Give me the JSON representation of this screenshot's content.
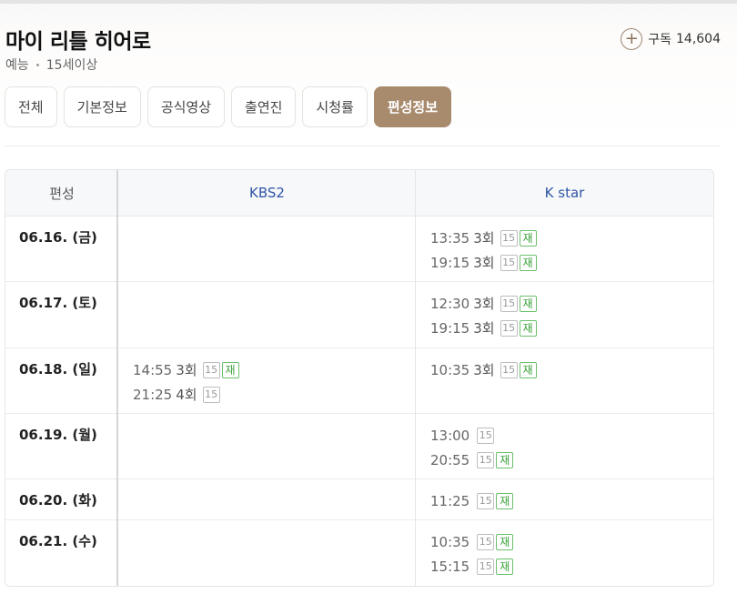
{
  "program": {
    "title": "마이 리틀 히어로",
    "genre": "예능",
    "rating": "15세이상"
  },
  "subscribe": {
    "icon": "plus-icon",
    "label": "구독",
    "count": "14,604"
  },
  "tabs": [
    {
      "label": "전체"
    },
    {
      "label": "기본정보"
    },
    {
      "label": "공식영상"
    },
    {
      "label": "출연진"
    },
    {
      "label": "시청률"
    },
    {
      "label": "편성정보",
      "active": true
    }
  ],
  "schedule": {
    "header": {
      "date_col": "편성",
      "channel1": "KBS2",
      "channel2": "K star"
    },
    "badges": {
      "age": "15",
      "rerun": "재"
    },
    "rows": [
      {
        "date": "06.16. (금)",
        "kbs2": [],
        "kstar": [
          {
            "time": "13:35",
            "ep": "3회",
            "rerun": true
          },
          {
            "time": "19:15",
            "ep": "3회",
            "rerun": true
          }
        ]
      },
      {
        "date": "06.17. (토)",
        "kbs2": [],
        "kstar": [
          {
            "time": "12:30",
            "ep": "3회",
            "rerun": true
          },
          {
            "time": "19:15",
            "ep": "3회",
            "rerun": true
          }
        ]
      },
      {
        "date": "06.18. (일)",
        "kbs2": [
          {
            "time": "14:55",
            "ep": "3회",
            "rerun": true
          },
          {
            "time": "21:25",
            "ep": "4회",
            "rerun": false
          }
        ],
        "kstar": [
          {
            "time": "10:35",
            "ep": "3회",
            "rerun": true
          }
        ]
      },
      {
        "date": "06.19. (월)",
        "kbs2": [],
        "kstar": [
          {
            "time": "13:00",
            "ep": "",
            "rerun": false
          },
          {
            "time": "20:55",
            "ep": "",
            "rerun": true
          }
        ]
      },
      {
        "date": "06.20. (화)",
        "kbs2": [],
        "kstar": [
          {
            "time": "11:25",
            "ep": "",
            "rerun": true
          }
        ]
      },
      {
        "date": "06.21. (수)",
        "kbs2": [],
        "kstar": [
          {
            "time": "10:35",
            "ep": "",
            "rerun": true
          },
          {
            "time": "15:15",
            "ep": "",
            "rerun": true
          }
        ]
      }
    ]
  },
  "colors": {
    "accent": "#a88a6d",
    "channel": "#2f55a6",
    "rerun": "#3aa23a"
  }
}
